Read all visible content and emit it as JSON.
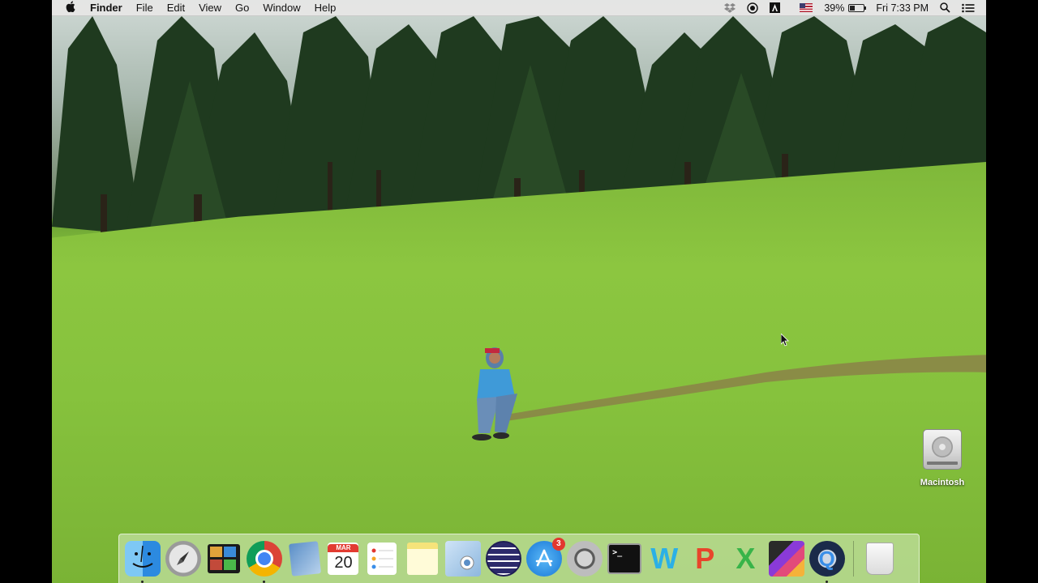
{
  "menubar": {
    "apple_icon": "apple-icon",
    "app_name": "Finder",
    "menus": [
      "File",
      "Edit",
      "View",
      "Go",
      "Window",
      "Help"
    ],
    "status_icons": [
      "dropbox-icon",
      "record-icon",
      "adobe-icon",
      "us-flag-icon"
    ],
    "battery_percent": "39%",
    "battery_level": 0.39,
    "clock": "Fri 7:33 PM",
    "spotlight_icon": "search-icon",
    "notification_icon": "list-icon"
  },
  "desktop": {
    "wallpaper": "green meadow with pine trees",
    "icons": [
      {
        "label": "Macintosh",
        "icon": "hard-drive-icon"
      }
    ]
  },
  "dock": {
    "items": [
      {
        "name": "finder",
        "icon": "finder-icon",
        "running": true
      },
      {
        "name": "launchpad",
        "icon": "launchpad-icon",
        "running": false
      },
      {
        "name": "photo-booth",
        "icon": "photos-icon",
        "running": false
      },
      {
        "name": "chrome",
        "icon": "chrome-icon",
        "running": true
      },
      {
        "name": "preview",
        "icon": "preview-icon",
        "running": false
      },
      {
        "name": "calendar",
        "icon": "calendar-icon",
        "running": false,
        "month": "MAR",
        "day": "20"
      },
      {
        "name": "reminders",
        "icon": "reminders-icon",
        "running": false
      },
      {
        "name": "notes",
        "icon": "notes-icon",
        "running": false
      },
      {
        "name": "image-capture",
        "icon": "image-capture-icon",
        "running": false
      },
      {
        "name": "eclipse",
        "icon": "eclipse-icon",
        "running": false
      },
      {
        "name": "app-store",
        "icon": "app-store-icon",
        "running": false,
        "badge": "3"
      },
      {
        "name": "system-preferences",
        "icon": "gear-icon",
        "running": false
      },
      {
        "name": "terminal",
        "icon": "terminal-icon",
        "running": false,
        "prompt": ">_"
      },
      {
        "name": "word",
        "icon": "word-icon",
        "running": false,
        "glyph": "W"
      },
      {
        "name": "powerpoint",
        "icon": "powerpoint-icon",
        "running": false,
        "glyph": "P"
      },
      {
        "name": "excel",
        "icon": "excel-icon",
        "running": false,
        "glyph": "X"
      },
      {
        "name": "final-cut-pro",
        "icon": "final-cut-icon",
        "running": false
      },
      {
        "name": "quicktime",
        "icon": "quicktime-icon",
        "running": true,
        "glyph": "Q"
      },
      {
        "name": "trash",
        "icon": "trash-icon",
        "running": false
      }
    ]
  }
}
